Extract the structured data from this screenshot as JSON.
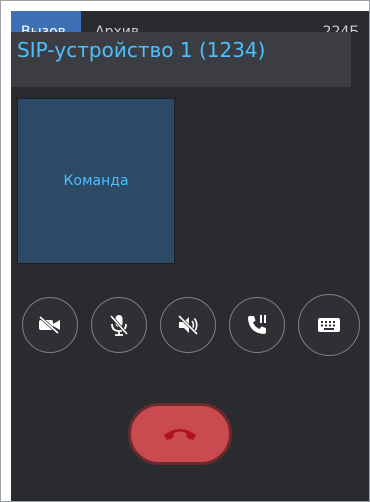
{
  "tabs": [
    {
      "label": "Вызов",
      "active": true
    },
    {
      "label": "Архив",
      "active": false
    }
  ],
  "tabs_counter": "224Б",
  "call": {
    "caller_name": "SIP-устройство 1 (1234)",
    "command_tile_label": "Команда"
  },
  "controls": [
    {
      "name": "video-off-button",
      "icon": "video-off-icon"
    },
    {
      "name": "mute-mic-button",
      "icon": "mic-off-icon"
    },
    {
      "name": "mute-speaker-button",
      "icon": "speaker-off-icon"
    },
    {
      "name": "hold-call-button",
      "icon": "phone-pause-icon"
    },
    {
      "name": "keypad-button",
      "icon": "keyboard-icon"
    }
  ],
  "hangup": {
    "icon": "phone-hangup-icon"
  },
  "colors": {
    "overlay_bg": "#2a2b2f",
    "caller_bar_bg": "#3b3d42",
    "accent_text": "#4cc0ff",
    "command_tile_bg": "#2c4a66",
    "hangup_bg": "#c94a4f",
    "active_tab_bg": "#3c6fb3"
  }
}
